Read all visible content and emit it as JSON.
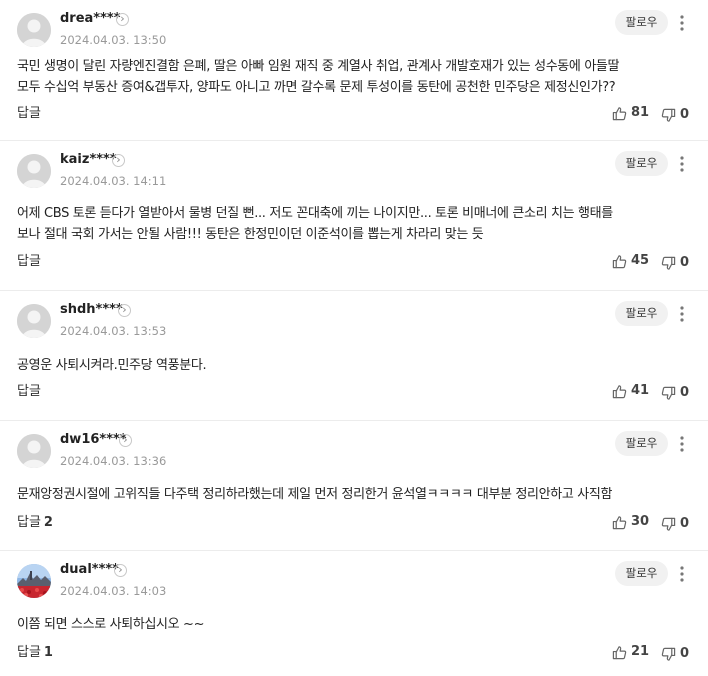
{
  "follow_label": "팔로우",
  "reply_label": "답글",
  "comments": [
    {
      "username": "drea****",
      "date": "2024.04.03. 13:50",
      "text_lines": [
        "국민 생명이 달린 자량엔진결함 은폐, 딸은 아빠 임원 재직 중 계열사 취업, 관계사 개발호재가 있는 성수동에 아들딸",
        "모두 수십억 부동산 증여&갭투자, 양파도 아니고 까면 갈수록 문제 투성이를 동탄에 공천한 민주당은 제정신인가??"
      ],
      "reply_count": "",
      "likes": "81",
      "dislikes": "0",
      "avatar": "default"
    },
    {
      "username": "kaiz****",
      "date": "2024.04.03. 14:11",
      "text_lines": [
        "어제 CBS 토론 듣다가 열받아서 물병 던질 뻔... 저도 꼰대축에 끼는 나이지만... 토론 비매너에 큰소리 치는 행태를",
        "보나 절대 국회 가서는 안될 사람!!! 동탄은 한정민이던 이준석이를 뽑는게 차라리 맞는 듯"
      ],
      "reply_count": "",
      "likes": "45",
      "dislikes": "0",
      "avatar": "default"
    },
    {
      "username": "shdh****",
      "date": "2024.04.03. 13:53",
      "text_lines": [
        "공영운 사퇴시켜라.민주당 역풍분다."
      ],
      "reply_count": "",
      "likes": "41",
      "dislikes": "0",
      "avatar": "default"
    },
    {
      "username": "dw16****",
      "date": "2024.04.03. 13:36",
      "text_lines": [
        "문재앙정권시절에 고위직들 다주택 정리하라했는데 제일 먼저 정리한거 윤석열ㅋㅋㅋㅋ 대부분 정리안하고 사직함"
      ],
      "reply_count": "2",
      "likes": "30",
      "dislikes": "0",
      "avatar": "default"
    },
    {
      "username": "dual****",
      "date": "2024.04.03. 14:03",
      "text_lines": [
        "이쯤 되면 스스로 사퇴하십시오 ~~"
      ],
      "reply_count": "1",
      "likes": "21",
      "dislikes": "0",
      "avatar": "photo"
    }
  ]
}
